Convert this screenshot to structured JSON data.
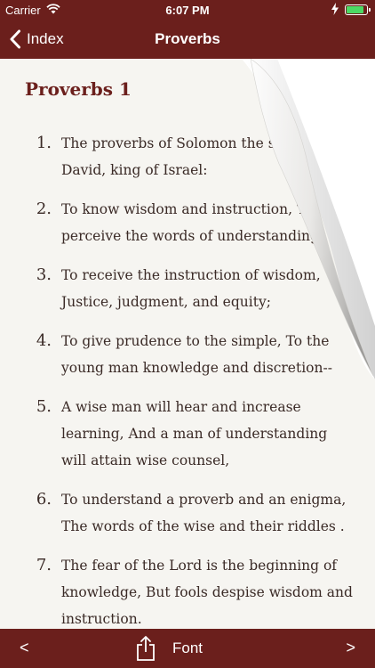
{
  "status_bar": {
    "carrier": "Carrier",
    "time": "6:07 PM",
    "battery_level": 0.85
  },
  "nav": {
    "back_label": "Index",
    "title": "Proverbs"
  },
  "chapter_title": "Proverbs 1",
  "verses": [
    {
      "num": "1.",
      "text": "The proverbs of Solomon the son of David, king of Israel:"
    },
    {
      "num": "2.",
      "text": "To know wisdom and instruction, To perceive the words of understanding,"
    },
    {
      "num": "3.",
      "text": "To receive the instruction of wisdom, Justice, judgment, and equity;"
    },
    {
      "num": "4.",
      "text": "To give prudence to the simple, To the young man knowledge and discretion--"
    },
    {
      "num": "5.",
      "text": "A wise man will hear and increase learning, And a man of understanding will attain wise counsel,"
    },
    {
      "num": "6.",
      "text": "To understand a proverb and an enigma, The words of the wise and their riddles ."
    },
    {
      "num": "7.",
      "text": "The fear of the Lord is the beginning of knowledge, But fools despise wisdom and instruction."
    }
  ],
  "toolbar": {
    "prev_label": "<",
    "font_label": "Font",
    "next_label": ">"
  },
  "colors": {
    "bar": "#6b1f1c",
    "title": "#6b1f1c",
    "text": "#3a2a26",
    "background": "#f6f5f1"
  }
}
